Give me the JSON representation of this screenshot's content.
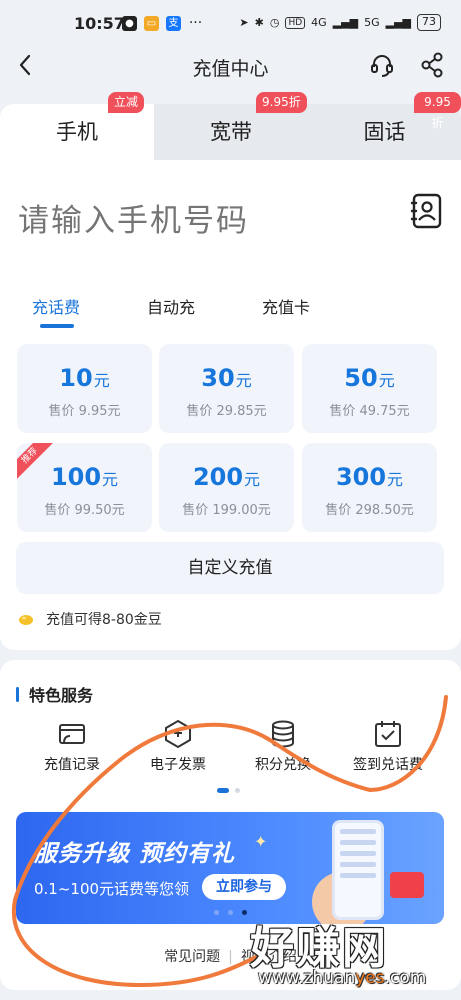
{
  "status_bar": {
    "time": "10:57",
    "battery": "73",
    "network1": "4G",
    "network2": "5G",
    "hd": "HD"
  },
  "navbar": {
    "title": "充值中心"
  },
  "tabs": [
    {
      "label": "手机",
      "tag": "立减",
      "active": true
    },
    {
      "label": "宽带",
      "tag": "9.95折",
      "active": false
    },
    {
      "label": "固话",
      "tag": "9.95折",
      "active": false
    }
  ],
  "phone_input": {
    "placeholder": "请输入手机号码",
    "value": ""
  },
  "sub_tabs": [
    {
      "label": "充话费",
      "active": true
    },
    {
      "label": "自动充",
      "active": false
    },
    {
      "label": "充值卡",
      "active": false
    }
  ],
  "amounts": [
    {
      "value": "10",
      "unit": "元",
      "price": "售价 9.95元"
    },
    {
      "value": "30",
      "unit": "元",
      "price": "售价 29.85元"
    },
    {
      "value": "50",
      "unit": "元",
      "price": "售价 49.75元"
    },
    {
      "value": "100",
      "unit": "元",
      "price": "售价 99.50元",
      "tag": "推荐"
    },
    {
      "value": "200",
      "unit": "元",
      "price": "售价 199.00元"
    },
    {
      "value": "300",
      "unit": "元",
      "price": "售价 298.50元"
    }
  ],
  "custom_recharge": "自定义充值",
  "bean_note": "充值可得8-80金豆",
  "services": {
    "title": "特色服务",
    "items": [
      {
        "label": "充值记录",
        "icon": "card-icon"
      },
      {
        "label": "电子发票",
        "icon": "invoice-icon"
      },
      {
        "label": "积分兑换",
        "icon": "coins-icon"
      },
      {
        "label": "签到兑话费",
        "icon": "calendar-check-icon"
      }
    ]
  },
  "banner": {
    "headline": "服务升级 预约有礼",
    "sub": "0.1~100元话费等您领",
    "cta": "立即参与"
  },
  "footer": {
    "faq": "常见问题",
    "separator": "|",
    "video": "视频介绍"
  },
  "watermark": {
    "text": "好赚网",
    "url_pre": "www.zhuan",
    "url_hl": "yes",
    "url_post": ".com"
  },
  "colors": {
    "accent": "#1a73d9",
    "tag_red": "#f0505a",
    "annotation": "#f07a3c"
  }
}
